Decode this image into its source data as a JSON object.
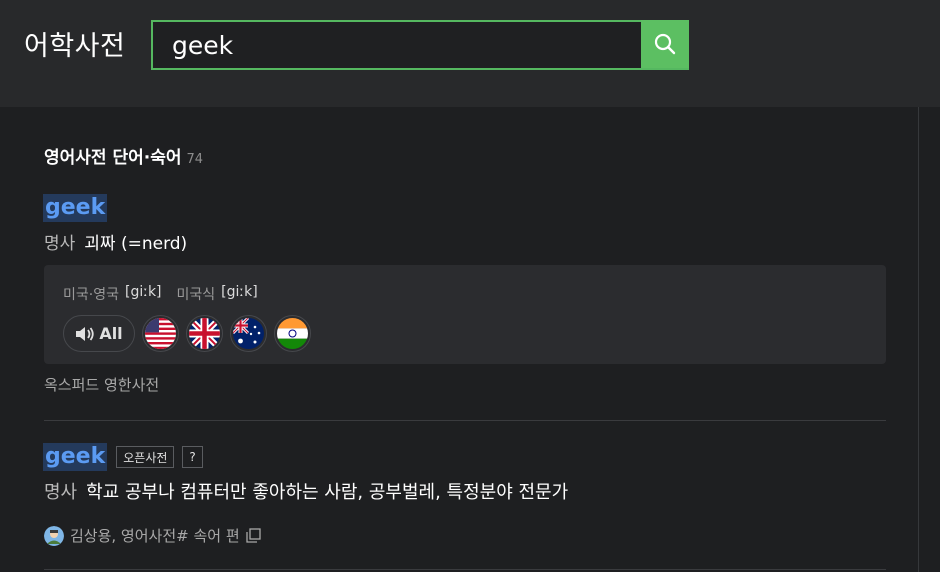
{
  "header": {
    "brand": "어학사전",
    "search_value": "geek",
    "search_placeholder": ""
  },
  "section": {
    "title": "영어사전 단어·숙어",
    "count": "74"
  },
  "entry1": {
    "word": "geek",
    "pos": "명사",
    "definition": "괴짜 (=nerd)",
    "pron_us_uk_label": "미국·영국",
    "pron_us_uk_ipa": "[giːk]",
    "pron_us_label": "미국식",
    "pron_us_ipa": "[giːk]",
    "audio_all_label": "All",
    "flags": [
      "us-flag-icon",
      "uk-flag-icon",
      "au-flag-icon",
      "in-flag-icon"
    ],
    "source": "옥스퍼드 영한사전"
  },
  "entry2": {
    "word": "geek",
    "tag": "오픈사전",
    "help": "?",
    "pos": "명사",
    "definition": "학교 공부나 컴퓨터만 좋아하는 사람, 공부벌레, 특정분야 전문가",
    "contributor": "김상용, 영어사전# 속어 편"
  },
  "colors": {
    "accent": "#5cbf62",
    "headword": "#5b9bf3",
    "headword_bg": "#243a5c"
  }
}
